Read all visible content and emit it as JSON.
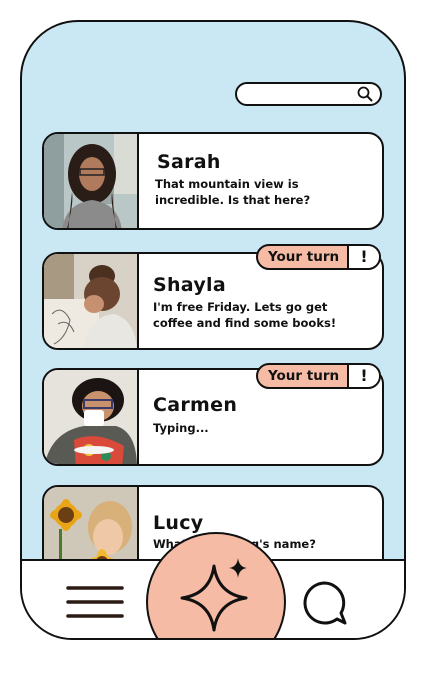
{
  "search": {
    "placeholder": ""
  },
  "conversations": [
    {
      "name": "Sarah",
      "message": "That mountain view is incredible. Is that here?",
      "your_turn": false
    },
    {
      "name": "Shayla",
      "message": "I'm free Friday. Lets go get coffee and find some books!",
      "your_turn": true
    },
    {
      "name": "Carmen",
      "message": "Typing...",
      "your_turn": true
    },
    {
      "name": "Lucy",
      "message": "What's your dog's name?",
      "your_turn": false
    }
  ],
  "badge": {
    "label": "Your turn",
    "alert": "!"
  },
  "nav": {
    "menu_icon": "hamburger-menu-icon",
    "center_icon": "sparkle-icon",
    "chat_icon": "chat-bubble-icon"
  },
  "colors": {
    "background": "#c9e8f3",
    "accent": "#f6bba4",
    "card": "#ffffff",
    "outline": "#111111"
  }
}
